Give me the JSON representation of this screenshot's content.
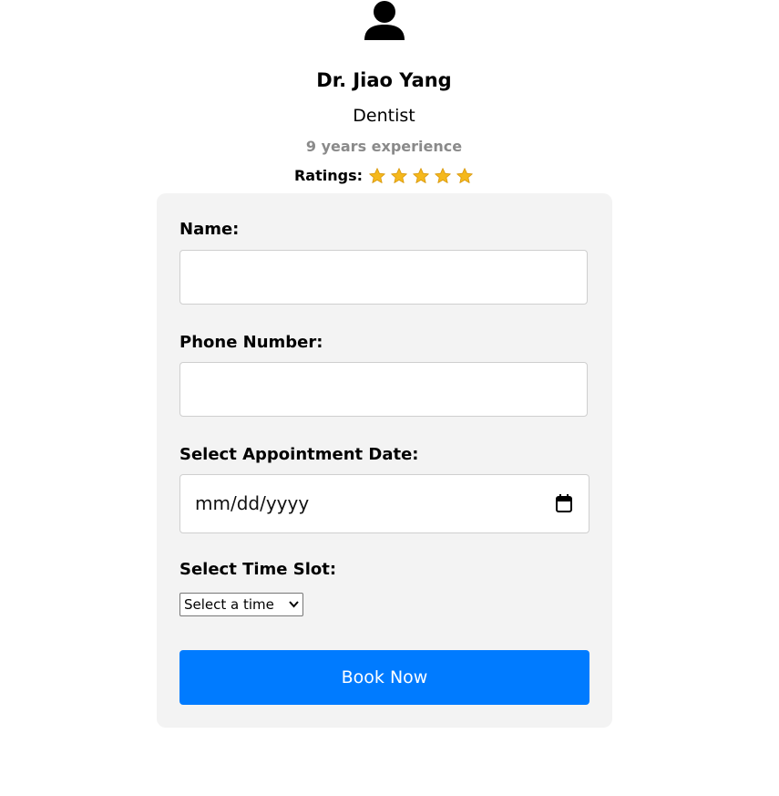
{
  "doctor": {
    "name": "Dr. Jiao Yang",
    "specialty": "Dentist",
    "experience": "9 years experience",
    "ratings_label": "Ratings:",
    "rating_stars": 5,
    "rating_icon": "star-icon"
  },
  "form": {
    "name_label": "Name:",
    "name_value": "",
    "phone_label": "Phone Number:",
    "phone_value": "",
    "date_label": "Select Appointment Date:",
    "date_placeholder": "mm/dd/yyyy",
    "time_label": "Select Time Slot:",
    "time_selected": "Select a time",
    "submit_label": "Book Now"
  },
  "colors": {
    "accent": "#007bff",
    "card_bg": "#f3f3f3",
    "star": "#f5b81c",
    "muted_text": "#8a8a8a"
  }
}
